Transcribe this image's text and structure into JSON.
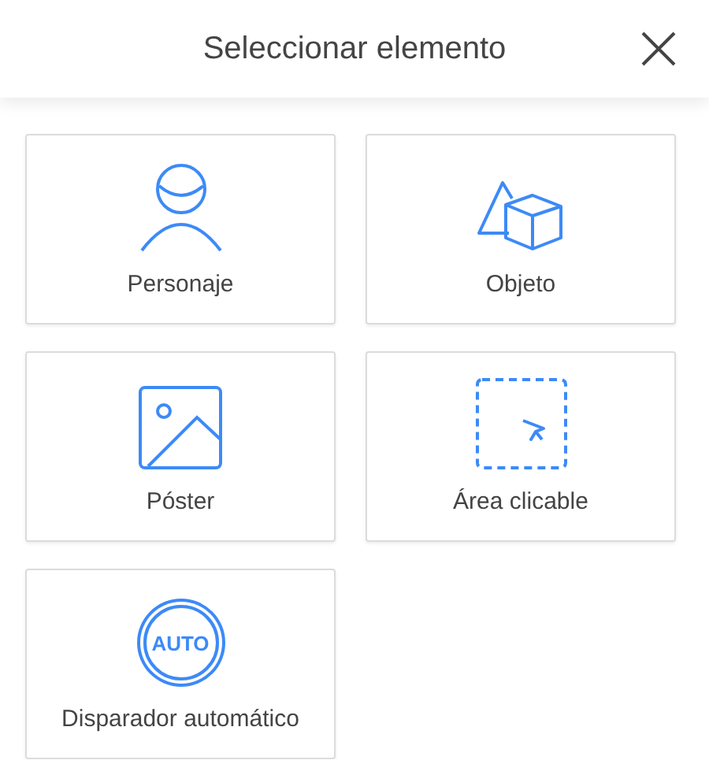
{
  "header": {
    "title": "Seleccionar elemento"
  },
  "items": [
    {
      "kind": "person",
      "label": "Personaje"
    },
    {
      "kind": "objects",
      "label": "Objeto"
    },
    {
      "kind": "poster",
      "label": "Póster"
    },
    {
      "kind": "area",
      "label": "Área clicable"
    },
    {
      "kind": "auto",
      "label": "Disparador automático",
      "badge": "AUTO"
    }
  ]
}
